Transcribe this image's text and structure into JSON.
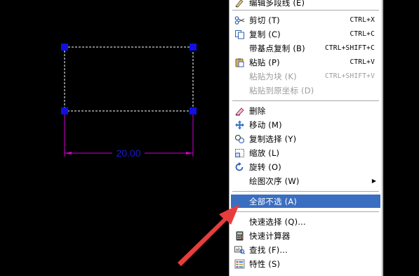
{
  "drawing": {
    "dimension_text": "20.00",
    "colors": {
      "grip": "#1010e0",
      "dimension": "#d000d0",
      "dim_text": "#1a1ad0",
      "outline": "#ffffff"
    }
  },
  "menu": {
    "items": [
      {
        "label": "编辑多段线 (E)",
        "shortcut": "",
        "icon": "pen-icon",
        "enabled": true
      },
      {
        "label": "剪切 (T)",
        "shortcut": "CTRL+X",
        "icon": "scissors-icon",
        "enabled": true
      },
      {
        "label": "复制 (C)",
        "shortcut": "CTRL+C",
        "icon": "copy-icon",
        "enabled": true
      },
      {
        "label": "带基点复制 (B)",
        "shortcut": "CTRL+SHIFT+C",
        "icon": "",
        "enabled": true
      },
      {
        "label": "粘贴 (P)",
        "shortcut": "CTRL+V",
        "icon": "paste-icon",
        "enabled": true
      },
      {
        "label": "粘贴为块 (K)",
        "shortcut": "CTRL+SHIFT+V",
        "icon": "",
        "enabled": false
      },
      {
        "label": "粘贴到原坐标 (D)",
        "shortcut": "",
        "icon": "",
        "enabled": false
      },
      {
        "label": "删除",
        "shortcut": "",
        "icon": "eraser-icon",
        "enabled": true
      },
      {
        "label": "移动 (M)",
        "shortcut": "",
        "icon": "move-icon",
        "enabled": true
      },
      {
        "label": "复制选择 (Y)",
        "shortcut": "",
        "icon": "copy-selection-icon",
        "enabled": true
      },
      {
        "label": "缩放 (L)",
        "shortcut": "",
        "icon": "scale-icon",
        "enabled": true
      },
      {
        "label": "旋转 (O)",
        "shortcut": "",
        "icon": "rotate-icon",
        "enabled": true
      },
      {
        "label": "绘图次序 (W)",
        "shortcut": "",
        "icon": "",
        "enabled": true,
        "submenu": "▶"
      },
      {
        "label": "全部不选 (A)",
        "shortcut": "",
        "icon": "",
        "enabled": true,
        "selected": true
      },
      {
        "label": "快速选择 (Q)...",
        "shortcut": "",
        "icon": "",
        "enabled": true
      },
      {
        "label": "快速计算器",
        "shortcut": "",
        "icon": "calculator-icon",
        "enabled": true
      },
      {
        "label": "查找 (F)...",
        "shortcut": "",
        "icon": "find-icon",
        "enabled": true
      },
      {
        "label": "特性 (S)",
        "shortcut": "",
        "icon": "properties-icon",
        "enabled": true
      }
    ]
  }
}
